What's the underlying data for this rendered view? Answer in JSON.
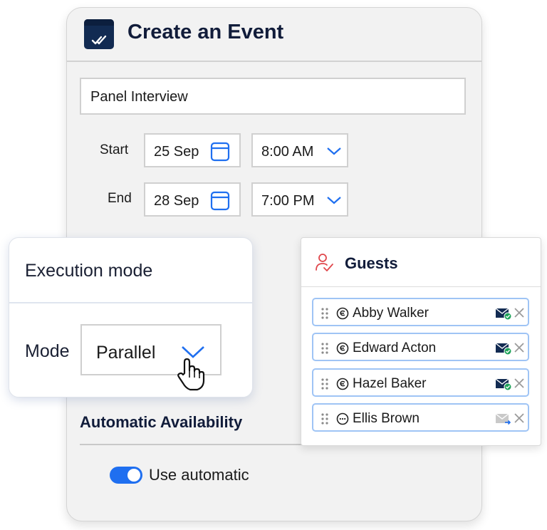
{
  "event": {
    "title": "Create an Event",
    "title_input_value": "Panel Interview",
    "start_label": "Start",
    "start_date": "25 Sep",
    "start_time": "8:00 AM",
    "end_label": "End",
    "end_date": "28 Sep",
    "end_time": "7:00 PM"
  },
  "availability": {
    "section_title": "Automatic Availability",
    "toggle_label": "Use automatic",
    "toggle_on": true
  },
  "execution": {
    "title": "Execution mode",
    "mode_label": "Mode",
    "mode_value": "Parallel"
  },
  "guests": {
    "title": "Guests",
    "list": [
      {
        "name": "Abby Walker",
        "status_icon": "accepted-status-icon",
        "mail_state": "sent"
      },
      {
        "name": "Edward Acton",
        "status_icon": "accepted-status-icon",
        "mail_state": "sent"
      },
      {
        "name": "Hazel Baker",
        "status_icon": "accepted-status-icon",
        "mail_state": "sent"
      },
      {
        "name": "Ellis Brown",
        "status_icon": "pending-status-icon",
        "mail_state": "pending"
      }
    ]
  },
  "colors": {
    "accent": "#1f6ff0",
    "navy": "#122b52",
    "success": "#1fa35a",
    "guest_icon": "#e0474c"
  }
}
